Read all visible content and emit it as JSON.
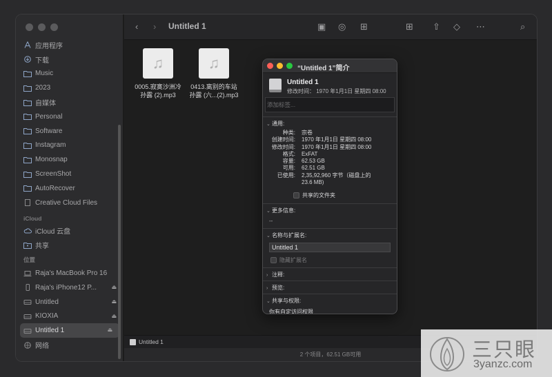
{
  "sidebar": {
    "favorites": [
      {
        "label": "应用程序",
        "icon": "apps-icon"
      },
      {
        "label": "下载",
        "icon": "download-icon"
      },
      {
        "label": "Music",
        "icon": "folder-icon"
      },
      {
        "label": "2023",
        "icon": "folder-icon"
      },
      {
        "label": "自媒体",
        "icon": "folder-icon"
      },
      {
        "label": "Personal",
        "icon": "folder-icon"
      },
      {
        "label": "Software",
        "icon": "folder-icon"
      },
      {
        "label": "Instagram",
        "icon": "folder-icon"
      },
      {
        "label": "Monosnap",
        "icon": "folder-icon"
      },
      {
        "label": "ScreenShot",
        "icon": "folder-icon"
      },
      {
        "label": "AutoRecover",
        "icon": "folder-icon"
      },
      {
        "label": "Creative Cloud Files",
        "icon": "document-icon"
      }
    ],
    "icloud_head": "iCloud",
    "icloud": [
      {
        "label": "iCloud 云盘",
        "icon": "cloud-icon"
      },
      {
        "label": "共享",
        "icon": "shared-folder-icon"
      }
    ],
    "locations_head": "位置",
    "locations": [
      {
        "label": "Raja's MacBook Pro 16",
        "icon": "laptop-icon",
        "eject": false
      },
      {
        "label": "Raja's iPhone12 P...",
        "icon": "phone-icon",
        "eject": true
      },
      {
        "label": "Untitled",
        "icon": "drive-icon",
        "eject": true
      },
      {
        "label": "KIOXIA",
        "icon": "drive-icon",
        "eject": true
      },
      {
        "label": "Untitled 1",
        "icon": "drive-icon",
        "eject": true,
        "selected": true
      },
      {
        "label": "网络",
        "icon": "network-icon",
        "eject": false
      }
    ]
  },
  "toolbar": {
    "title": "Untitled 1"
  },
  "files": [
    {
      "line1": "0005.寂寞沙洲冷",
      "line2": "孙露 (2).mp3"
    },
    {
      "line1": "0413.离别的车站",
      "line2": "孙露 (六...(2).mp3"
    }
  ],
  "pathbar": {
    "label": "Untitled 1"
  },
  "statusbar": {
    "text": "2 个项目，62.51 GB可用"
  },
  "info": {
    "title": "“Untitled 1”简介",
    "name": "Untitled 1",
    "modified": "修改时间： 1970 年1月1日 星期四 08:00",
    "tag_placeholder": "添加标签...",
    "general_head": "通用:",
    "general": [
      {
        "k": "种类:",
        "v": "宗卷"
      },
      {
        "k": "创建时间:",
        "v": "1970 年1月1日 星期四 08:00"
      },
      {
        "k": "修改时间:",
        "v": "1970 年1月1日 星期四 08:00"
      },
      {
        "k": "格式:",
        "v": "ExFAT"
      },
      {
        "k": "容量:",
        "v": "62.53 GB"
      },
      {
        "k": "可用:",
        "v": "62.51 GB"
      },
      {
        "k": "已使用:",
        "v": "2,35,92,960 字节（磁盘上的 23.6 MB)"
      }
    ],
    "shared_folder": "共享的文件夹",
    "more_head": "更多信息:",
    "more_value": "--",
    "name_head": "名称与扩展名:",
    "name_value": "Untitled 1",
    "hide_ext": "隐藏扩展名",
    "comments_head": "注释:",
    "preview_head": "预览:",
    "perm_head": "共享与权限:",
    "perm_text": "你有自定访问权限"
  },
  "watermark": {
    "cn": "三只眼",
    "url": "3yanzc.com"
  }
}
